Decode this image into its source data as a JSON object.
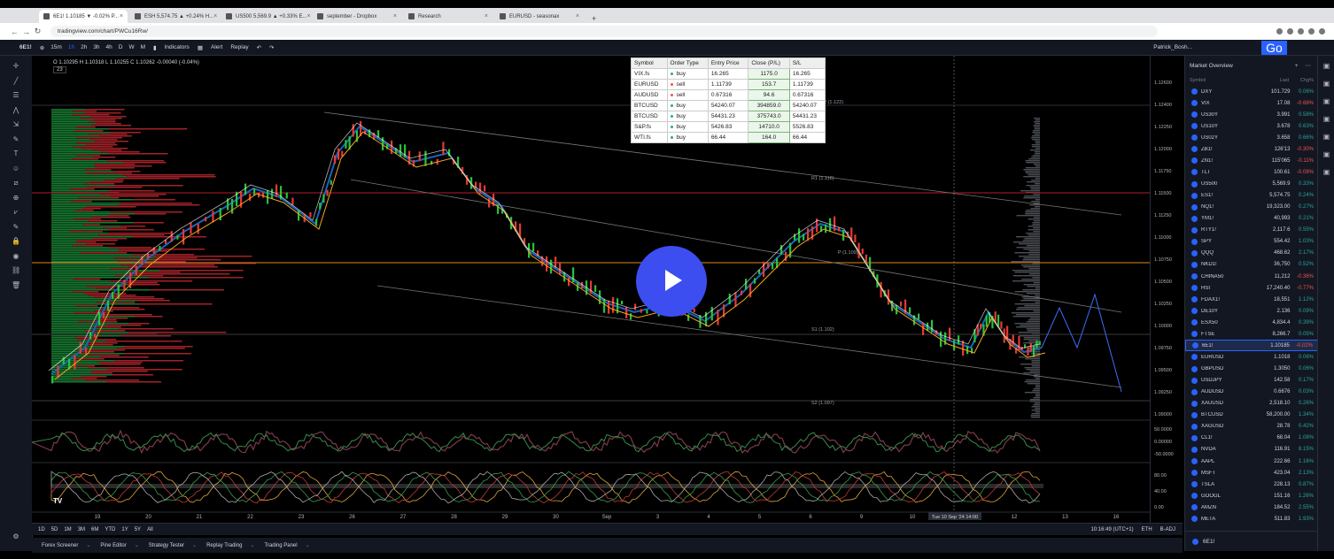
{
  "browser": {
    "tabs": [
      {
        "label": "6E1! 1.10185 ▼ -0.02% P..."
      },
      {
        "label": "ESH 5,574.75 ▲ +0.24% H..."
      },
      {
        "label": "US500 5,569.9 ▲ +0.33% E..."
      },
      {
        "label": "september - Dropbox"
      },
      {
        "label": "Research"
      },
      {
        "label": "EURUSD - seasonax"
      }
    ],
    "url": "tradingview.com/chart/PWCu16Rw/"
  },
  "toolbar": {
    "symbol": "6E1!",
    "intervals": [
      "15m",
      "1h",
      "2h",
      "3h",
      "4h",
      "D",
      "W",
      "M"
    ],
    "indicators_label": "Indicators",
    "alert_label": "Alert",
    "replay_label": "Replay",
    "user_label": "Patrick_Bosh...",
    "go_label": "Go"
  },
  "chart": {
    "ohlc_text": "O 1.10295 H 1.10318 L 1.10255 C 1.10262 -0.00040 (-0.04%)",
    "indicator_count": "23",
    "pivot_labels": [
      "R2 (1.122)",
      "R1 (1.116)",
      "P (1.109)",
      "S1 (1.102)",
      "S2 (1.097)"
    ],
    "price_ticks": [
      "1.12600",
      "1.12400",
      "1.12250",
      "1.12000",
      "1.11750",
      "1.11500",
      "1.11250",
      "1.11000",
      "1.10750",
      "1.10500",
      "1.10250",
      "1.10000",
      "1.09750",
      "1.09500",
      "1.09250",
      "1.09000"
    ],
    "date_ticks": [
      "19",
      "20",
      "21",
      "22",
      "23",
      "26",
      "27",
      "28",
      "29",
      "30",
      "Sep",
      "3",
      "4",
      "5",
      "6",
      "9",
      "10",
      "11",
      "12",
      "13",
      "16"
    ],
    "osc1_ticks": [
      "50.0000",
      "0.00000",
      "-50.0000"
    ],
    "osc2_ticks": [
      "80.00",
      "40.00",
      "0.00"
    ],
    "crosshair_date": "Tue 10 Sep '24  14:00"
  },
  "orders": {
    "headers": [
      "Symbol",
      "Order Type",
      "Entry Price",
      "Close (P/L)",
      "S/L"
    ],
    "rows": [
      {
        "symbol": "VIX.fs",
        "type": "buy",
        "entry": "16.265",
        "pl": "1175.0",
        "sl": "16.265"
      },
      {
        "symbol": "EURUSD",
        "type": "sell",
        "entry": "1.11739",
        "pl": "153.7",
        "sl": "1.11739"
      },
      {
        "symbol": "AUDUSD",
        "type": "sell",
        "entry": "0.67316",
        "pl": "94.6",
        "sl": "0.67316"
      },
      {
        "symbol": "BTCUSD",
        "type": "buy",
        "entry": "54240.07",
        "pl": "394859.0",
        "sl": "54240.07"
      },
      {
        "symbol": "BTCUSD",
        "type": "buy",
        "entry": "54431.23",
        "pl": "375743.0",
        "sl": "54431.23"
      },
      {
        "symbol": "S&P.fs",
        "type": "buy",
        "entry": "5426.83",
        "pl": "14710.0",
        "sl": "5526.83"
      },
      {
        "symbol": "WTI.fs",
        "type": "buy",
        "entry": "66.44",
        "pl": "164.0",
        "sl": "66.44"
      }
    ]
  },
  "bottom": {
    "ranges": [
      "1D",
      "5D",
      "1M",
      "3M",
      "6M",
      "YTD",
      "1Y",
      "5Y",
      "All"
    ],
    "time": "10:16:49 (UTC+1)",
    "session": "ETH",
    "adj": "B-ADJ",
    "panels": [
      "Forex Screener",
      "Pine Editor",
      "Strategy Tester",
      "Replay Trading",
      "Trading Panel"
    ]
  },
  "watchlist": {
    "title": "Market Overview",
    "col_symbol": "Symbol",
    "col_last": "Last",
    "col_chg": "Chg%",
    "footer_symbol": "6E1!",
    "rows": [
      {
        "s": "DXY",
        "l": "101.729",
        "c": "0.06%",
        "dir": "up"
      },
      {
        "s": "VIX",
        "l": "17.08",
        "c": "-0.68%",
        "dir": "dn"
      },
      {
        "s": "US30Y",
        "l": "3.991",
        "c": "0.58%",
        "dir": "up"
      },
      {
        "s": "US10Y",
        "l": "3.678",
        "c": "0.63%",
        "dir": "up"
      },
      {
        "s": "US02Y",
        "l": "3.658",
        "c": "0.66%",
        "dir": "up"
      },
      {
        "s": "ZB1!",
        "l": "126'13",
        "c": "-0.30%",
        "dir": "dn"
      },
      {
        "s": "ZN1!",
        "l": "115'065",
        "c": "-0.11%",
        "dir": "dn"
      },
      {
        "s": "TLT",
        "l": "100.61",
        "c": "-0.08%",
        "dir": "dn"
      },
      {
        "s": "US500",
        "l": "5,569.9",
        "c": "0.33%",
        "dir": "up"
      },
      {
        "s": "ES1!",
        "l": "5,574.75",
        "c": "0.24%",
        "dir": "up"
      },
      {
        "s": "NQ1!",
        "l": "19,323.00",
        "c": "0.27%",
        "dir": "up"
      },
      {
        "s": "YM1!",
        "l": "40,993",
        "c": "0.21%",
        "dir": "up"
      },
      {
        "s": "RTY1!",
        "l": "2,117.6",
        "c": "0.55%",
        "dir": "up"
      },
      {
        "s": "SPY",
        "l": "554.42",
        "c": "1.03%",
        "dir": "up"
      },
      {
        "s": "QQQ",
        "l": "468.62",
        "c": "2.17%",
        "dir": "up"
      },
      {
        "s": "NKD1!",
        "l": "36,750",
        "c": "0.52%",
        "dir": "up"
      },
      {
        "s": "CHINA50",
        "l": "11,212",
        "c": "-0.36%",
        "dir": "dn"
      },
      {
        "s": "HSI",
        "l": "17,240.40",
        "c": "-0.77%",
        "dir": "dn"
      },
      {
        "s": "FDAX1!",
        "l": "18,551",
        "c": "1.12%",
        "dir": "up"
      },
      {
        "s": "DE10Y",
        "l": "2.136",
        "c": "0.09%",
        "dir": "up"
      },
      {
        "s": "ESX50",
        "l": "4,834.4",
        "c": "0.39%",
        "dir": "up"
      },
      {
        "s": "FTSE",
        "l": "8,266.7",
        "c": "0.05%",
        "dir": "up"
      },
      {
        "s": "6E1!",
        "l": "1.10185",
        "c": "-0.02%",
        "dir": "dn"
      },
      {
        "s": "EURUSD",
        "l": "1.1018",
        "c": "0.06%",
        "dir": "up"
      },
      {
        "s": "GBPUSD",
        "l": "1.3050",
        "c": "0.06%",
        "dir": "up"
      },
      {
        "s": "USDJPY",
        "l": "142.58",
        "c": "0.17%",
        "dir": "up"
      },
      {
        "s": "AUDUSD",
        "l": "0.6676",
        "c": "0.03%",
        "dir": "up"
      },
      {
        "s": "XAUUSD",
        "l": "2,518.10",
        "c": "0.26%",
        "dir": "up"
      },
      {
        "s": "BTCUSD",
        "l": "58,200.00",
        "c": "1.34%",
        "dir": "up"
      },
      {
        "s": "XAGUSD",
        "l": "28.78",
        "c": "0.42%",
        "dir": "up"
      },
      {
        "s": "CL1!",
        "l": "68.04",
        "c": "1.08%",
        "dir": "up"
      },
      {
        "s": "NVDA",
        "l": "116.91",
        "c": "8.15%",
        "dir": "up"
      },
      {
        "s": "AAPL",
        "l": "222.66",
        "c": "1.16%",
        "dir": "up"
      },
      {
        "s": "MSFT",
        "l": "423.04",
        "c": "2.13%",
        "dir": "up"
      },
      {
        "s": "TSLA",
        "l": "228.13",
        "c": "0.87%",
        "dir": "up"
      },
      {
        "s": "GOOGL",
        "l": "151.16",
        "c": "1.26%",
        "dir": "up"
      },
      {
        "s": "AMZN",
        "l": "184.52",
        "c": "2.55%",
        "dir": "up"
      },
      {
        "s": "META",
        "l": "511.83",
        "c": "1.93%",
        "dir": "up"
      }
    ]
  }
}
